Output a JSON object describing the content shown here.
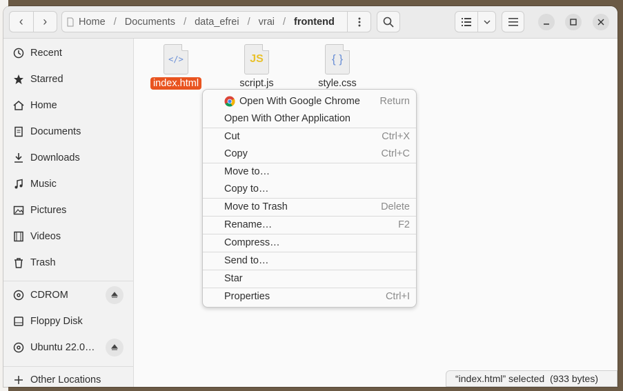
{
  "path": {
    "crumbs": [
      "Home",
      "Documents",
      "data_efrei",
      "vrai"
    ],
    "current": "frontend",
    "separator": "/"
  },
  "sidebar": {
    "items": [
      {
        "label": "Recent",
        "icon": "clock-icon"
      },
      {
        "label": "Starred",
        "icon": "star-icon"
      },
      {
        "label": "Home",
        "icon": "home-icon"
      },
      {
        "label": "Documents",
        "icon": "document-icon"
      },
      {
        "label": "Downloads",
        "icon": "download-icon"
      },
      {
        "label": "Music",
        "icon": "music-icon"
      },
      {
        "label": "Pictures",
        "icon": "picture-icon"
      },
      {
        "label": "Videos",
        "icon": "video-icon"
      },
      {
        "label": "Trash",
        "icon": "trash-icon"
      }
    ],
    "devices": [
      {
        "label": "CDROM",
        "icon": "disc-icon",
        "eject": true
      },
      {
        "label": "Floppy Disk",
        "icon": "drive-icon",
        "eject": false
      },
      {
        "label": "Ubuntu 22.0…",
        "icon": "disc-icon",
        "eject": true
      }
    ],
    "other": "Other Locations"
  },
  "files": [
    {
      "name": "index.html",
      "glyph": "</>",
      "selected": true
    },
    {
      "name": "script.js",
      "glyph": "JS",
      "selected": false
    },
    {
      "name": "style.css",
      "glyph": "{ }",
      "selected": false
    }
  ],
  "context_menu": {
    "items": [
      {
        "label": "Open With Google Chrome",
        "accel": "Return"
      },
      {
        "label": "Open With Other Application",
        "accel": ""
      },
      {
        "label": "Cut",
        "accel": "Ctrl+X"
      },
      {
        "label": "Copy",
        "accel": "Ctrl+C"
      },
      {
        "label": "Move to…",
        "accel": ""
      },
      {
        "label": "Copy to…",
        "accel": ""
      },
      {
        "label": "Move to Trash",
        "accel": "Delete"
      },
      {
        "label": "Rename…",
        "accel": "F2"
      },
      {
        "label": "Compress…",
        "accel": ""
      },
      {
        "label": "Send to…",
        "accel": ""
      },
      {
        "label": "Star",
        "accel": ""
      },
      {
        "label": "Properties",
        "accel": "Ctrl+I"
      }
    ]
  },
  "status": "“index.html” selected  (933 bytes)",
  "colors": {
    "accent": "#e95420",
    "js": "#e9c12a",
    "code": "#6a8fd6"
  }
}
